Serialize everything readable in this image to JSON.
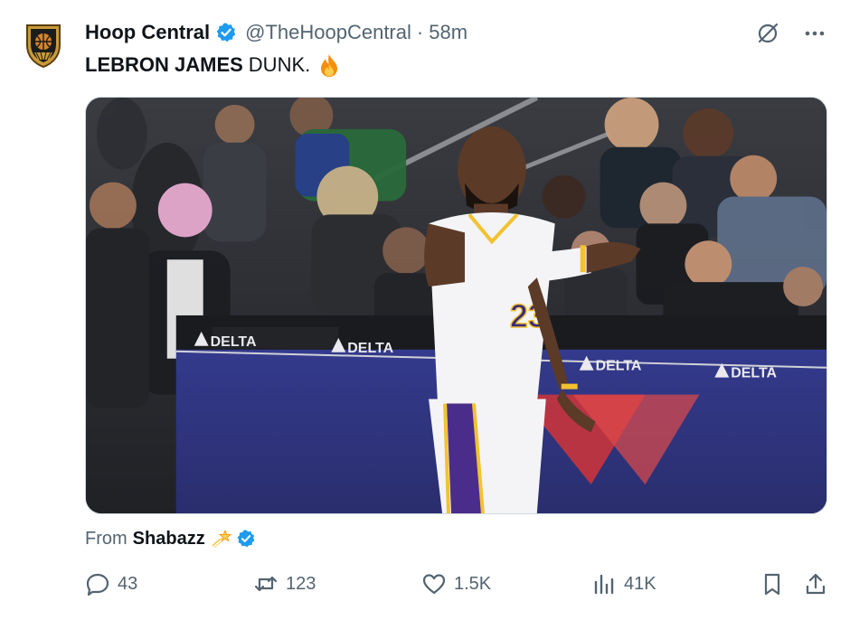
{
  "author": {
    "display_name": "Hoop Central",
    "handle": "@TheHoopCentral",
    "separator": "·",
    "time": "58m",
    "verified_icon": "verified-badge-icon",
    "avatar_icon": "hoop-central-shield-logo"
  },
  "tweet": {
    "text_bold": "LEBRON JAMES",
    "text_rest": "DUNK.",
    "emoji_icon": "fire-icon"
  },
  "media": {
    "jersey_number": "23",
    "ad_board_text": "DELTA"
  },
  "source": {
    "prefix": "From",
    "name": "Shabazz",
    "emoji_icon": "shooting-star-icon",
    "verified_icon": "verified-badge-icon"
  },
  "actions": {
    "replies": "43",
    "reposts": "123",
    "likes": "1.5K",
    "views": "41K"
  },
  "colors": {
    "verified_blue": "#1d9bf0",
    "text_primary": "#0f1419",
    "text_secondary": "#536471"
  }
}
